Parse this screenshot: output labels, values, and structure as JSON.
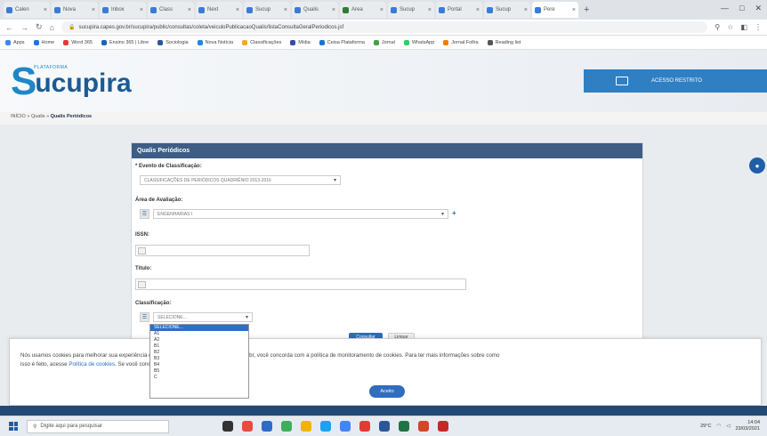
{
  "browser": {
    "tabs": [
      {
        "label": "Calen",
        "color": "#3b7bd6"
      },
      {
        "label": "Nova",
        "color": "#3b7bd6"
      },
      {
        "label": "Inbox",
        "color": "#3b7bd6"
      },
      {
        "label": "Class",
        "color": "#3b7bd6"
      },
      {
        "label": "Next",
        "color": "#3b7bd6"
      },
      {
        "label": "Sucup",
        "color": "#3b7bd6"
      },
      {
        "label": "Qualis",
        "color": "#3b7bd6"
      },
      {
        "label": "Area",
        "color": "#2e7d32"
      },
      {
        "label": "Sucup",
        "color": "#3b7bd6"
      },
      {
        "label": "Portal",
        "color": "#3b7bd6"
      },
      {
        "label": "Sucup",
        "color": "#3b7bd6"
      },
      {
        "label": "Pere",
        "color": "#3b7bd6"
      }
    ],
    "url": "sucupira.capes.gov.br/sucupira/public/consultas/coleta/veiculoPublicacaoQualis/listaConsultaGeralPeriodicos.jsf",
    "bookmarks": [
      "Apps",
      "Home",
      "Word 365",
      "Ensino 365 | Libre",
      "Sociologia",
      "Nova Notícia",
      "Classificações",
      "Mídia",
      "Ceisa Plataforma",
      "Jornal",
      "WhatsApp",
      "Jornal Folha",
      "Reading list"
    ]
  },
  "site": {
    "logo_s": "S",
    "logo_text": "ucupira",
    "logo_sub": "PLATAFORMA",
    "restricted_access_label": "ACESSO RESTRITO",
    "breadcrumb_home": "INÍCIO",
    "breadcrumb_sep1": "»",
    "breadcrumb_mid": "Qualis",
    "breadcrumb_sep2": "»",
    "breadcrumb_current": "Qualis Periódicos"
  },
  "form": {
    "panel_title": "Qualis Periódicos",
    "evento_label": "* Evento de Classificação:",
    "evento_value": "CLASSIFICAÇÕES DE PERIÓDICOS QUADRIÊNIO 2013-2016",
    "area_label": "Área de Avaliação:",
    "area_value": "ENGENHARIAS I",
    "issn_label": "ISSN:",
    "titulo_label": "Título:",
    "classificacao_label": "Classificação:",
    "classificacao_value": "SELECIONE...",
    "consultar_label": "Consultar",
    "limpar_label": "Limpar"
  },
  "dropdown_options": [
    "SELECIONE...",
    "A1",
    "A2",
    "B1",
    "B2",
    "B3",
    "B4",
    "B5",
    "C"
  ],
  "cookie": {
    "text1": "Nós usamos cookies para melhorar sua experiência de navegação no portal. Ao utilizar o gov.br, você concorda com a política de monitoramento de cookies. Para ter mais informações sobre como",
    "text2a": "isso é feito, acesse ",
    "link_text": "Política de cookies",
    "text2b": ". Se você concorda, clique em ACEITO.",
    "button_label": "Aceito"
  },
  "taskbar": {
    "search_placeholder": "Digite aqui para pesquisar",
    "tray_temp": "29°C",
    "tray_time": "14:04",
    "tray_date": "23/03/2021"
  },
  "colors": {
    "brand_blue": "#1f86c9",
    "panel_header": "#3d5d85",
    "accent": "#2f6dc0"
  }
}
